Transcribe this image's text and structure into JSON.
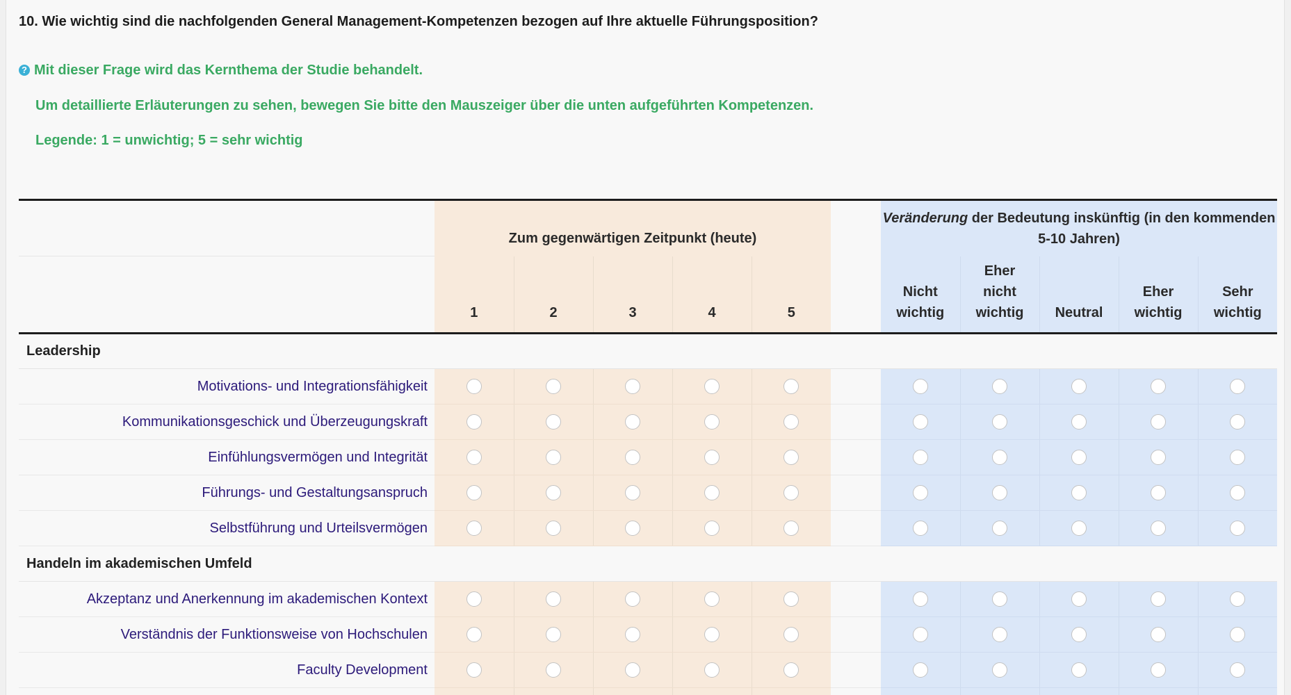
{
  "question": {
    "title": "10. Wie wichtig sind die nachfolgenden General Management-Kompetenzen bezogen auf Ihre aktuelle Führungsposition?",
    "help_icon_glyph": "?",
    "help_lines": [
      "Mit dieser Frage wird das Kernthema der Studie behandelt.",
      "Um detaillierte Erläuterungen zu sehen, bewegen Sie bitte den Mauszeiger über die unten aufgeführten Kompetenzen.",
      "Legende: 1 = unwichtig; 5 = sehr wichtig"
    ]
  },
  "matrix": {
    "current_header": "Zum gegenwärtigen Zeitpunkt (heute)",
    "future_header_em": "Veränderung",
    "future_header_rest": " der Bedeutung inskünftig (in den kommenden 5-10 Jahren)",
    "current_scale": [
      "1",
      "2",
      "3",
      "4",
      "5"
    ],
    "future_scale": [
      [
        "Nicht",
        "wichtig"
      ],
      [
        "Eher",
        "nicht",
        "wichtig"
      ],
      [
        "Neutral"
      ],
      [
        "Eher",
        "wichtig"
      ],
      [
        "Sehr",
        "wichtig"
      ]
    ],
    "groups": [
      {
        "name": "Leadership",
        "items": [
          "Motivations- und Integrationsfähigkeit",
          "Kommunikationsgeschick und Überzeugungskraft",
          "Einfühlungsvermögen und Integrität",
          "Führungs- und Gestaltungsanspruch",
          "Selbstführung und Urteilsvermögen"
        ]
      },
      {
        "name": "Handeln im akademischen Umfeld",
        "items": [
          "Akzeptanz und Anerkennung im akademischen Kontext",
          "Verständnis der Funktionsweise von Hochschulen",
          "Faculty Development",
          ""
        ]
      }
    ]
  },
  "colors": {
    "current_bg": "#f8eadc",
    "future_bg": "#dbe7f8",
    "help_text": "#3aa962",
    "item_text": "#2c1a7a"
  }
}
